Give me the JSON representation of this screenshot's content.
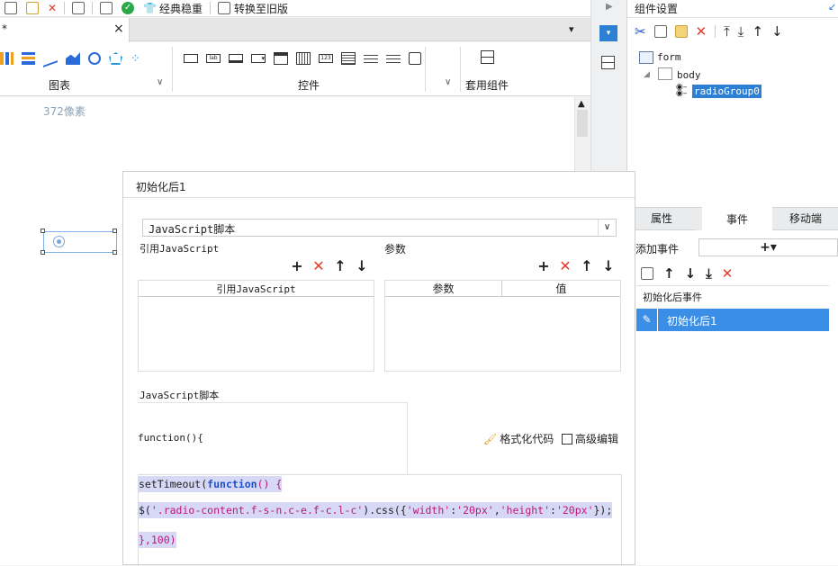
{
  "toolbar": {
    "classic_label": "经典稳重",
    "convert_label": "转换至旧版"
  },
  "tab": {
    "label": "*",
    "close": "×"
  },
  "ribbon": {
    "chart_group": "图表",
    "control_group": "控件",
    "template_group": "套用组件"
  },
  "canvas": {
    "ruler_text": "372像素"
  },
  "right": {
    "title": "组件设置",
    "tree": {
      "root": "form",
      "body": "body",
      "item": "radioGroup0"
    },
    "tabs": [
      "属性",
      "事件",
      "移动端"
    ],
    "add_event_label": "添加事件",
    "add_icon": "+▾",
    "section_title": "初始化后事件",
    "event_item": "初始化后1"
  },
  "dialog": {
    "title": "初始化后1",
    "select_value": "JavaScript脚本",
    "ref_label": "引用JavaScript",
    "param_label": "参数",
    "ref_col": "引用JavaScript",
    "param_cols": [
      "参数",
      "值"
    ],
    "script_label": "JavaScript脚本",
    "func_sig": "function(){",
    "format_label": "格式化代码",
    "advanced_label": "高级编辑",
    "code": {
      "l1_a": "setTimeout(",
      "l1_b": "function",
      "l1_c": "() {",
      "l2_a": "$(",
      "l2_b": "'.radio-content.f-s-n.c-e.f-c.l-c'",
      "l2_c": ").css({",
      "l2_d": "'width'",
      "l2_e": ":",
      "l2_f": "'20px'",
      "l2_g": ",",
      "l2_h": "'height'",
      "l2_i": ":",
      "l2_j": "'20px'",
      "l2_k": "});",
      "l3_a": "},100)"
    }
  }
}
